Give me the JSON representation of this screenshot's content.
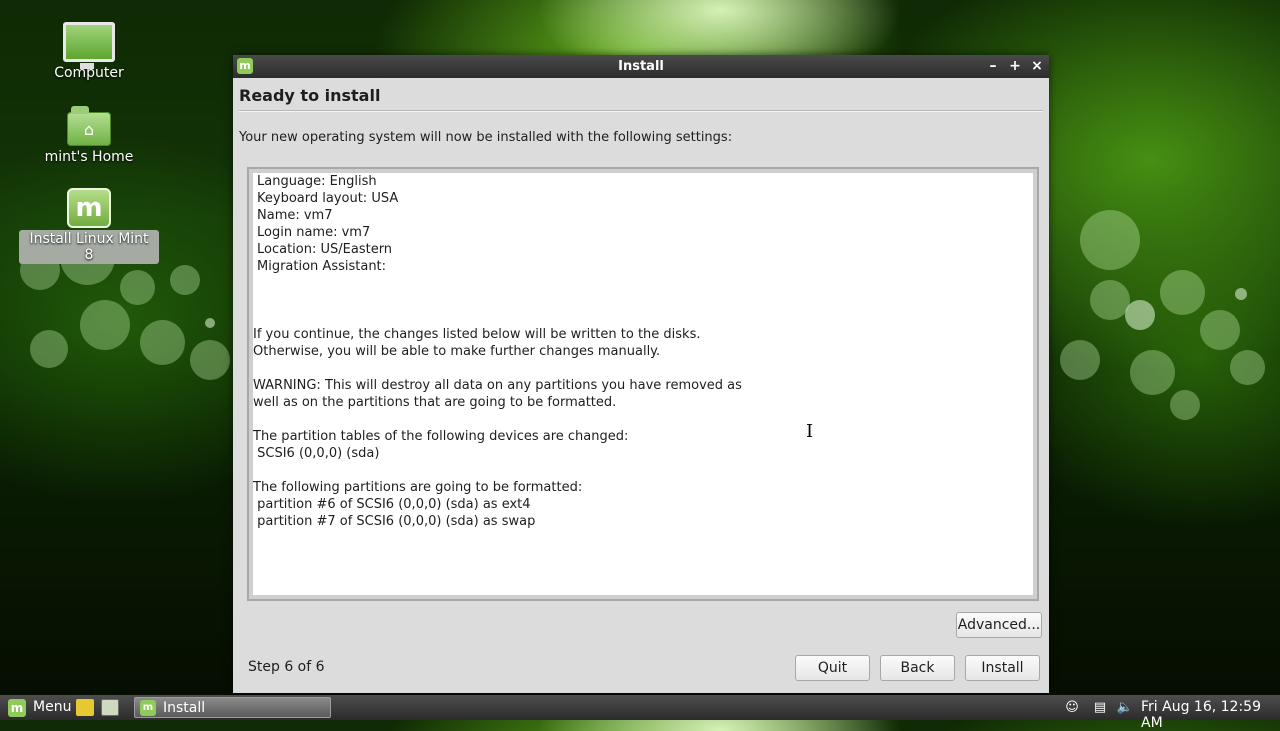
{
  "desktop": {
    "icons": [
      {
        "label": "Computer"
      },
      {
        "label": "mint's Home"
      },
      {
        "label": "Install Linux Mint 8"
      }
    ]
  },
  "window": {
    "title": "Install",
    "controls": {
      "minimize": "–",
      "maximize": "+",
      "close": "×"
    },
    "heading": "Ready to install",
    "intro": "Your new operating system will now be installed with the following settings:",
    "summary_lines": [
      "Language: English",
      "Keyboard layout: USA",
      "Name: vm7",
      "Login name: vm7",
      "Location: US/Eastern",
      "Migration Assistant:",
      "If you continue, the changes listed below will be written to the disks.",
      "Otherwise, you will be able to make further changes manually.",
      "WARNING: This will destroy all data on any partitions you have removed as",
      "well as on the partitions that are going to be formatted.",
      "The partition tables of the following devices are changed:",
      " SCSI6 (0,0,0) (sda)",
      "The following partitions are going to be formatted:",
      " partition #6 of SCSI6 (0,0,0) (sda) as ext4",
      " partition #7 of SCSI6 (0,0,0) (sda) as swap"
    ],
    "advanced_label": "Advanced...",
    "step_text": "Step 6 of 6",
    "quit_label": "Quit",
    "back_label": "Back",
    "install_label": "Install"
  },
  "taskbar": {
    "menu_label": "Menu",
    "task_label": "Install",
    "clock": "Fri Aug 16, 12:59 AM"
  },
  "colors": {
    "accent_green": "#8fca5a",
    "window_bg": "#dcdcdc",
    "titlebar": "#2c2c2c"
  }
}
